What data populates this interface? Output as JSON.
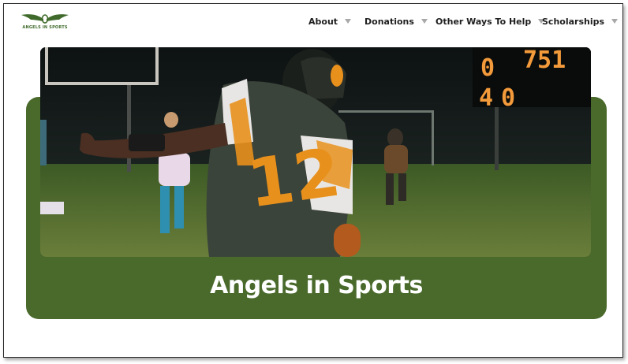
{
  "header": {
    "logo_text": "ANGELS IN SPORTS",
    "nav": [
      {
        "label": "About"
      },
      {
        "label": "Donations"
      },
      {
        "label": "Other Ways To Help"
      },
      {
        "label": "Scholarships"
      }
    ]
  },
  "hero": {
    "title": "Angels in Sports",
    "photo": {
      "jersey_number": "12",
      "scoreboard_top_left": "0",
      "scoreboard_top_right": "751",
      "scoreboard_bottom_left": "4",
      "scoreboard_bottom_mid": "0"
    }
  },
  "colors": {
    "brand_green": "#4a6a2c",
    "jersey_orange": "#e8901c",
    "scoreboard_orange": "#f39a3a"
  }
}
